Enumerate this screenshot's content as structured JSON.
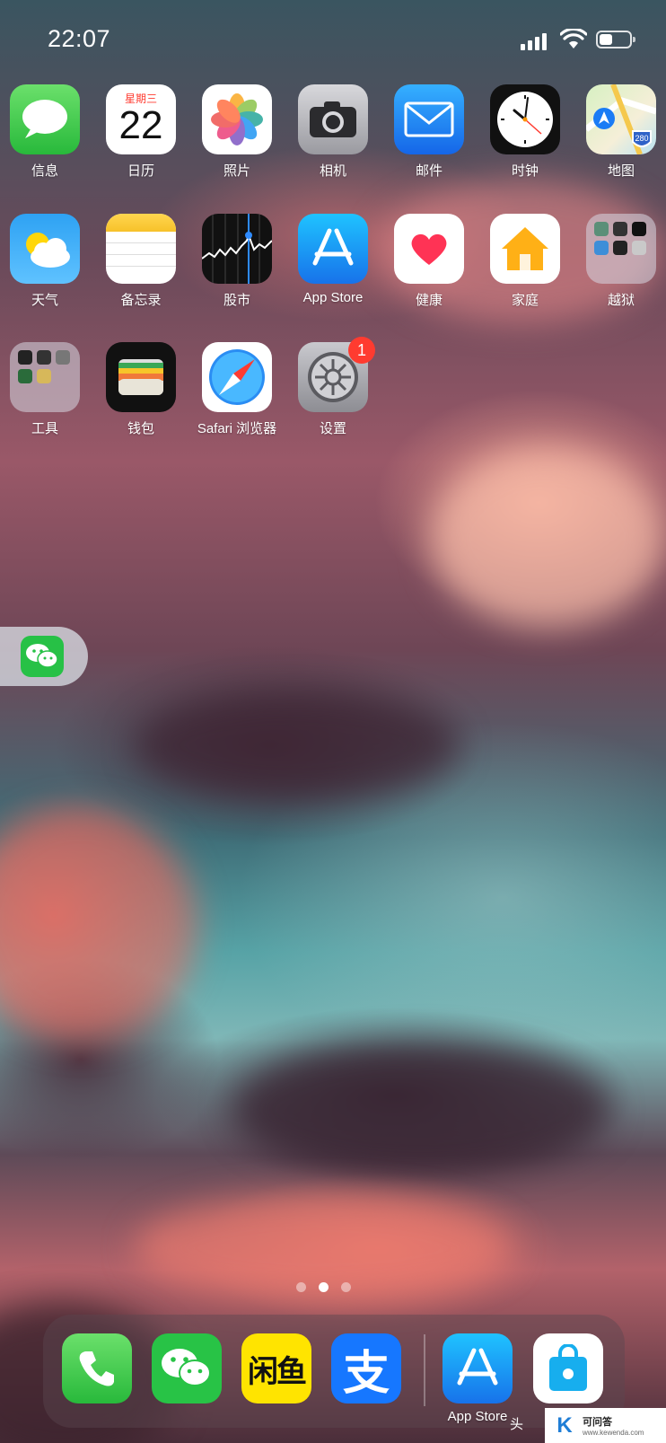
{
  "status_bar": {
    "time": "22:07",
    "signal_bars": 4,
    "wifi": "wifi-icon",
    "battery_percent": 45
  },
  "page": {
    "apps": [
      {
        "id": "messages",
        "label": "信息",
        "icon": "messages-icon",
        "color": "#34c759"
      },
      {
        "id": "calendar",
        "label": "日历",
        "icon": "calendar-icon",
        "weekday": "星期三",
        "day": "22"
      },
      {
        "id": "photos",
        "label": "照片",
        "icon": "photos-icon"
      },
      {
        "id": "camera",
        "label": "相机",
        "icon": "camera-icon"
      },
      {
        "id": "mail",
        "label": "邮件",
        "icon": "mail-icon",
        "color": "#1a8cff"
      },
      {
        "id": "clock",
        "label": "时钟",
        "icon": "clock-icon"
      },
      {
        "id": "maps",
        "label": "地图",
        "icon": "maps-icon",
        "shield": "280"
      },
      {
        "id": "weather",
        "label": "天气",
        "icon": "weather-icon"
      },
      {
        "id": "notes",
        "label": "备忘录",
        "icon": "notes-icon"
      },
      {
        "id": "stocks",
        "label": "股市",
        "icon": "stocks-icon"
      },
      {
        "id": "appstore",
        "label": "App Store",
        "icon": "app-store-icon",
        "color": "#1a8cff"
      },
      {
        "id": "health",
        "label": "健康",
        "icon": "health-heart-icon"
      },
      {
        "id": "home",
        "label": "家庭",
        "icon": "home-icon"
      },
      {
        "id": "jailbreak",
        "label": "越狱",
        "icon": "folder-icon"
      },
      {
        "id": "tools",
        "label": "工具",
        "icon": "folder-icon"
      },
      {
        "id": "wallet",
        "label": "钱包",
        "icon": "wallet-icon"
      },
      {
        "id": "safari",
        "label": "Safari 浏览器",
        "icon": "safari-compass-icon"
      },
      {
        "id": "settings",
        "label": "设置",
        "icon": "settings-gear-icon",
        "badge": "1"
      }
    ]
  },
  "floating_widget": {
    "icon": "wechat-icon"
  },
  "page_dots": {
    "count": 3,
    "active": 1
  },
  "dock": {
    "apps": [
      {
        "id": "phone",
        "icon": "phone-icon"
      },
      {
        "id": "wechat",
        "icon": "wechat-icon"
      },
      {
        "id": "xianyu",
        "icon": "xianyu-icon",
        "text": "闲鱼"
      },
      {
        "id": "alipay",
        "icon": "alipay-icon",
        "text": "支"
      },
      {
        "id": "appstore-recent",
        "icon": "app-store-icon",
        "label": "App Store"
      },
      {
        "id": "apple-store",
        "icon": "apple-store-bag-icon",
        "label_fragment": "头"
      }
    ]
  },
  "watermark": {
    "letter": "K",
    "title": "可问答",
    "url": "www.kewenda.com"
  }
}
